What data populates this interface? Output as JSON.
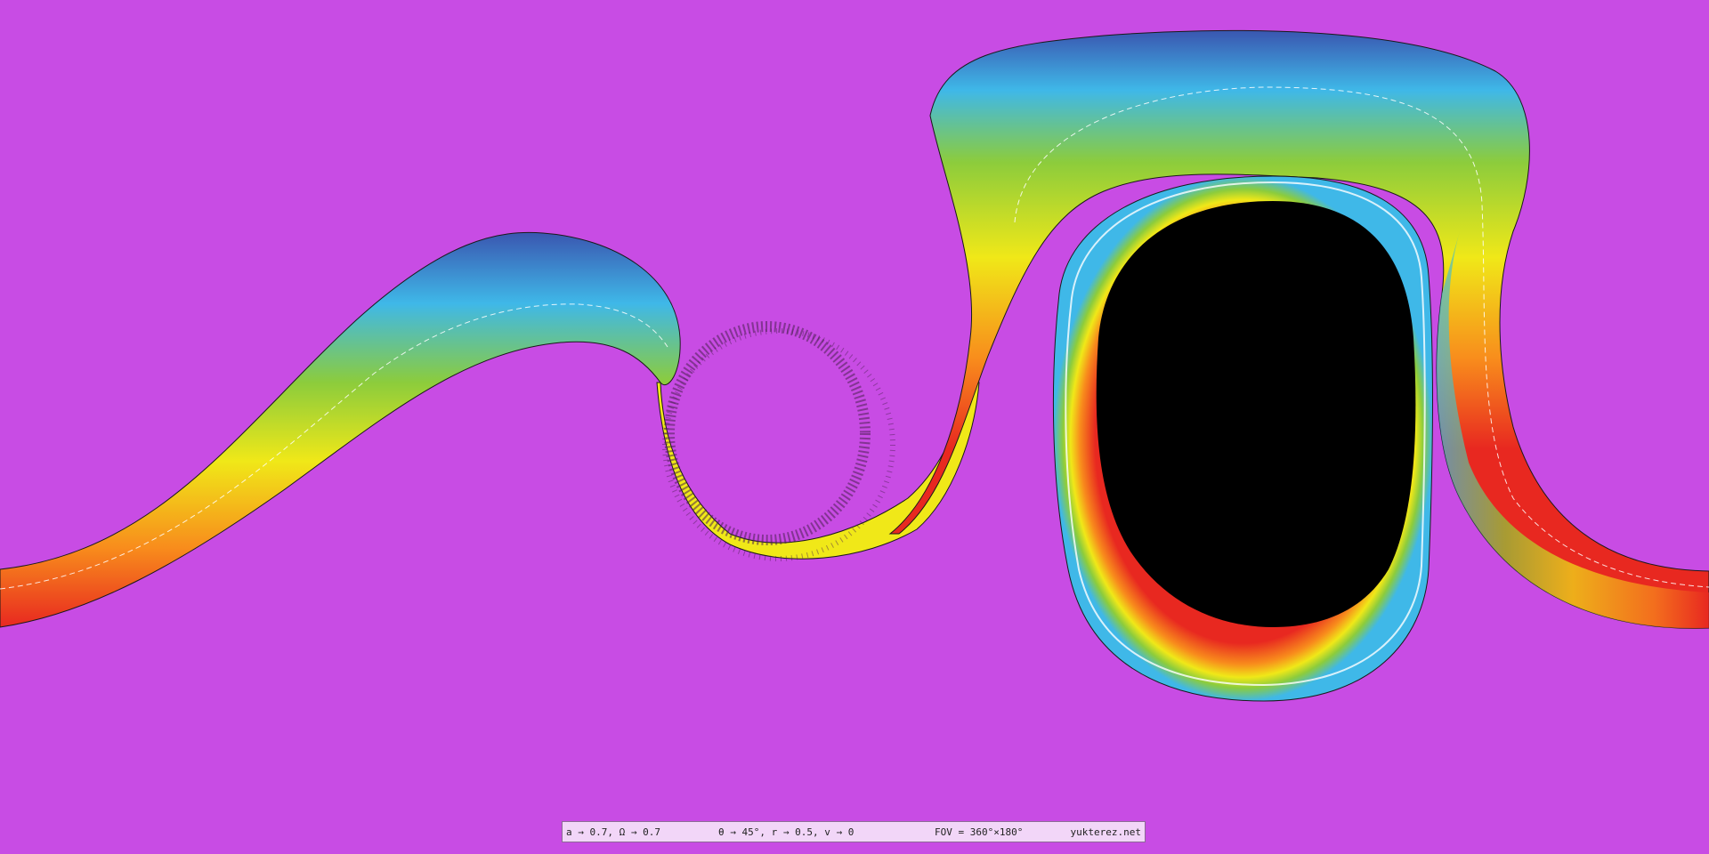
{
  "scene": {
    "background_color": "#c84ce4",
    "event_horizon_color": "#000000",
    "band_colors": [
      "#3a5ab8",
      "#3fb8e8",
      "#8ccc3c",
      "#f0e818",
      "#f88c1c",
      "#e82820"
    ]
  },
  "status_bar": {
    "spin": "a → 0.7, Ω → 0.7",
    "view": "θ → 45°, r → 0.5, v → 0",
    "fov": "FOV = 360°×180°",
    "credit": "yukterez.net"
  }
}
